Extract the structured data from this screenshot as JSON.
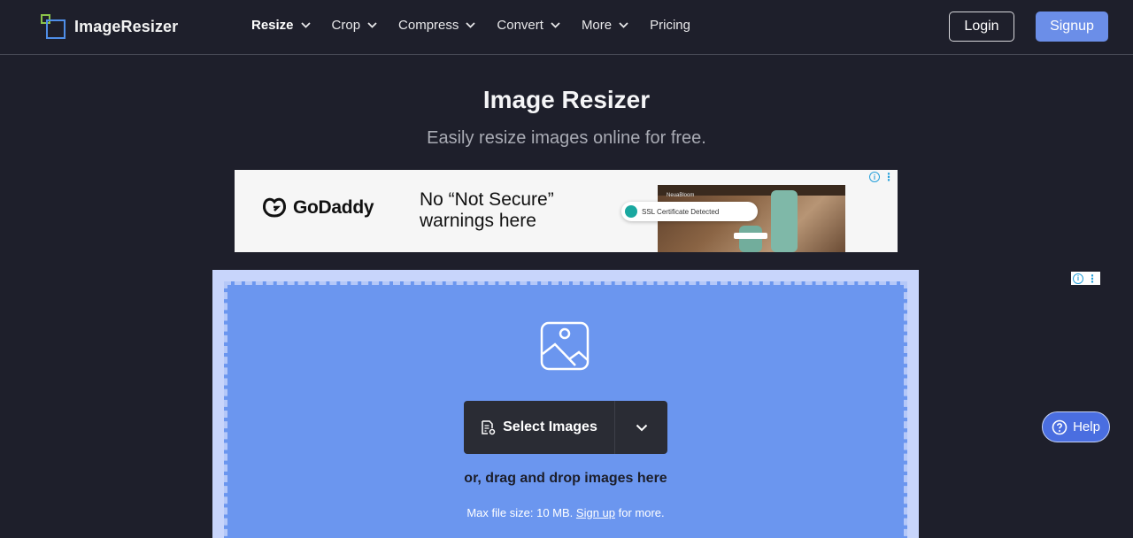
{
  "header": {
    "logo_text": "ImageResizer",
    "nav": [
      {
        "label": "Resize",
        "active": true,
        "dropdown": true
      },
      {
        "label": "Crop",
        "dropdown": true
      },
      {
        "label": "Compress",
        "dropdown": true
      },
      {
        "label": "Convert",
        "dropdown": true
      },
      {
        "label": "More",
        "dropdown": true
      },
      {
        "label": "Pricing",
        "dropdown": false
      }
    ],
    "login_label": "Login",
    "signup_label": "Signup"
  },
  "main": {
    "title": "Image Resizer",
    "subtitle": "Easily resize images online for free."
  },
  "ad": {
    "brand": "GoDaddy",
    "headline": "No “Not Secure” warnings here",
    "ssl_text": "SSL Certificate Detected",
    "site_name": "NeuaBloom"
  },
  "upload": {
    "select_label": "Select Images",
    "drag_text": "or, drag and drop images here",
    "max_prefix": "Max file size: 10 MB.",
    "signup_link": "Sign up",
    "max_suffix": "for more."
  },
  "help": {
    "label": "Help"
  },
  "colors": {
    "background": "#1e1f2b",
    "accent": "#6b8ee8",
    "upload_fill": "#6b96ef",
    "logo_green": "#8bc34a",
    "logo_blue": "#4f8ee8"
  }
}
